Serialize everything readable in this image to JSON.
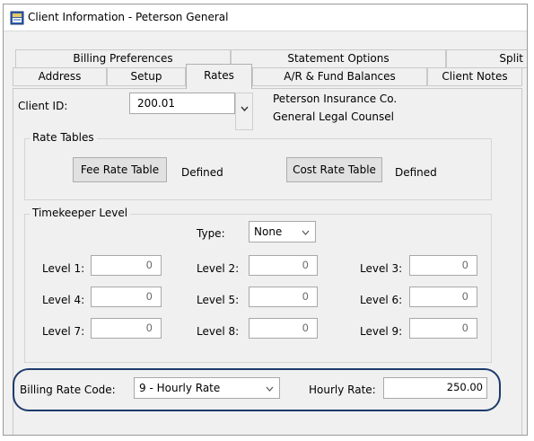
{
  "window": {
    "title": "Client Information - Peterson General"
  },
  "tabs": {
    "row1": [
      "Billing Preferences",
      "Statement Options",
      "Split"
    ],
    "row2": [
      "Address",
      "Setup",
      "Rates",
      "A/R & Fund Balances",
      "Client Notes"
    ],
    "active": "Rates"
  },
  "client": {
    "label": "Client ID:",
    "value": "200.01",
    "name_line1": "Peterson Insurance Co.",
    "name_line2": "General Legal Counsel"
  },
  "rate_tables": {
    "title": "Rate Tables",
    "fee_button": "Fee Rate Table",
    "fee_status": "Defined",
    "cost_button": "Cost Rate Table",
    "cost_status": "Defined"
  },
  "timekeeper": {
    "title": "Timekeeper Level",
    "type_label": "Type:",
    "type_value": "None",
    "levels": [
      {
        "label": "Level 1:",
        "value": "0"
      },
      {
        "label": "Level 2:",
        "value": "0"
      },
      {
        "label": "Level 3:",
        "value": "0"
      },
      {
        "label": "Level 4:",
        "value": "0"
      },
      {
        "label": "Level 5:",
        "value": "0"
      },
      {
        "label": "Level 6:",
        "value": "0"
      },
      {
        "label": "Level 7:",
        "value": "0"
      },
      {
        "label": "Level 8:",
        "value": "0"
      },
      {
        "label": "Level 9:",
        "value": "0"
      }
    ]
  },
  "billing": {
    "code_label": "Billing Rate Code:",
    "code_value": "9 - Hourly Rate",
    "rate_label": "Hourly Rate:",
    "rate_value": "250.00"
  },
  "colors": {
    "highlight_ring": "#1d3b6b",
    "window_bg": "#f0f0f0"
  }
}
